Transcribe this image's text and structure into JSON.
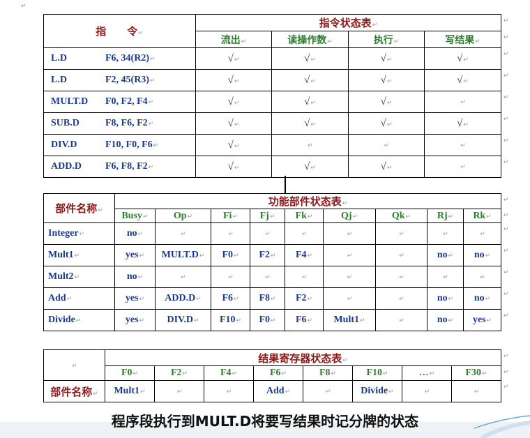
{
  "corner_mark": "↵",
  "para_mark": "↵",
  "check": "√",
  "instr_table": {
    "header_cell": "指　　令",
    "title": "指令状态表",
    "columns": [
      "流出",
      "读操作数",
      "执行",
      "写结果"
    ],
    "rows": [
      {
        "op": "L.D",
        "args": "F6, 34(R2)",
        "status": [
          true,
          true,
          true,
          true
        ]
      },
      {
        "op": "L.D",
        "args": "F2, 45(R3)",
        "status": [
          true,
          true,
          true,
          true
        ]
      },
      {
        "op": "MULT.D",
        "args": "F0, F2, F4",
        "status": [
          true,
          true,
          true,
          false
        ]
      },
      {
        "op": "SUB.D",
        "args": "F8, F6, F2",
        "status": [
          true,
          true,
          true,
          true
        ]
      },
      {
        "op": "DIV.D",
        "args": "F10, F0, F6",
        "status": [
          true,
          false,
          false,
          false
        ]
      },
      {
        "op": "ADD.D",
        "args": "F6, F8, F2",
        "status": [
          true,
          true,
          true,
          false
        ]
      }
    ]
  },
  "fu_table": {
    "header_cell": "部件名称",
    "title": "功能部件状态表",
    "columns": [
      "Busy",
      "Op",
      "Fi",
      "Fj",
      "Fk",
      "Qj",
      "Qk",
      "Rj",
      "Rk"
    ],
    "rows": [
      {
        "name": "Integer",
        "cells": [
          "no",
          "",
          "",
          "",
          "",
          "",
          "",
          "",
          ""
        ]
      },
      {
        "name": "Mult1",
        "cells": [
          "yes",
          "MULT.D",
          "F0",
          "F2",
          "F4",
          "",
          "",
          "no",
          "no"
        ]
      },
      {
        "name": "Mult2",
        "cells": [
          "no",
          "",
          "",
          "",
          "",
          "",
          "",
          "",
          ""
        ]
      },
      {
        "name": "Add",
        "cells": [
          "yes",
          "ADD.D",
          "F6",
          "F8",
          "F2",
          "",
          "",
          "no",
          "no"
        ]
      },
      {
        "name": "Divide",
        "cells": [
          "yes",
          "DIV.D",
          "F10",
          "F0",
          "F6",
          "Mult1",
          "",
          "no",
          "yes"
        ]
      }
    ]
  },
  "reg_table": {
    "title": "结果寄存器状态表",
    "columns": [
      "F0",
      "F2",
      "F4",
      "F6",
      "F8",
      "F10",
      "…",
      "F30"
    ],
    "row_label": "部件名称",
    "values": [
      "Mult1",
      "",
      "",
      "Add",
      "",
      "Divide",
      "",
      ""
    ]
  },
  "caption": "程序段执行到MULT.D将要写结果时记分牌的状态"
}
